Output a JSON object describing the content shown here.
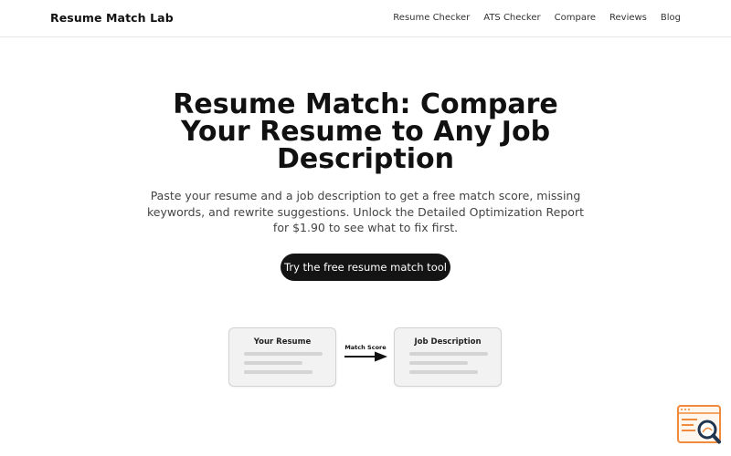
{
  "header": {
    "brand": "Resume Match Lab",
    "nav": [
      {
        "label": "Resume Checker"
      },
      {
        "label": "ATS Checker"
      },
      {
        "label": "Compare"
      },
      {
        "label": "Reviews"
      },
      {
        "label": "Blog"
      }
    ]
  },
  "hero": {
    "title": "Resume Match: Compare Your Resume to Any Job Description",
    "subtitle": "Paste your resume and a job description to get a free match score, missing keywords, and rewrite suggestions. Unlock the Detailed Optimization Report for $1.90 to see what to fix first.",
    "cta_label": "Try the free resume match tool"
  },
  "diagram": {
    "resume_card_title": "Your Resume",
    "job_card_title": "Job Description",
    "arrow_label": "Match Score"
  },
  "widget": {
    "icon": "search-document-icon"
  },
  "colors": {
    "accent_dark": "#141414",
    "widget_orange": "#f08a3c",
    "widget_navy": "#1f3550"
  }
}
